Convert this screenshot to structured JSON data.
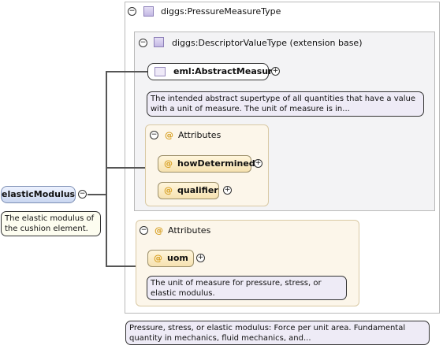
{
  "type": {
    "title": "diggs:PressureMeasureType",
    "note": "Pressure, stress, or elastic modulus: Force per unit area. Fundamental quantity in mechanics, fluid mechanics, and..."
  },
  "extension": {
    "title": "diggs:DescriptorValueType (extension base)",
    "element": "eml:AbstractMeasure",
    "element_note": "The intended abstract supertype of all quantities that have a value with a unit of measure. The unit of measure is in...",
    "attributes_label": "Attributes",
    "attributes": [
      {
        "name": "howDetermined"
      },
      {
        "name": "qualifier"
      }
    ]
  },
  "root": {
    "name": "elasticModulus",
    "note": "The elastic modulus of the cushion element."
  },
  "own_attributes": {
    "label": "Attributes",
    "attribute": "uom",
    "note": "The unit of measure for pressure, stress, or elastic modulus."
  },
  "glyphs": {
    "collapse": "−",
    "expand": "+",
    "at": "@"
  }
}
